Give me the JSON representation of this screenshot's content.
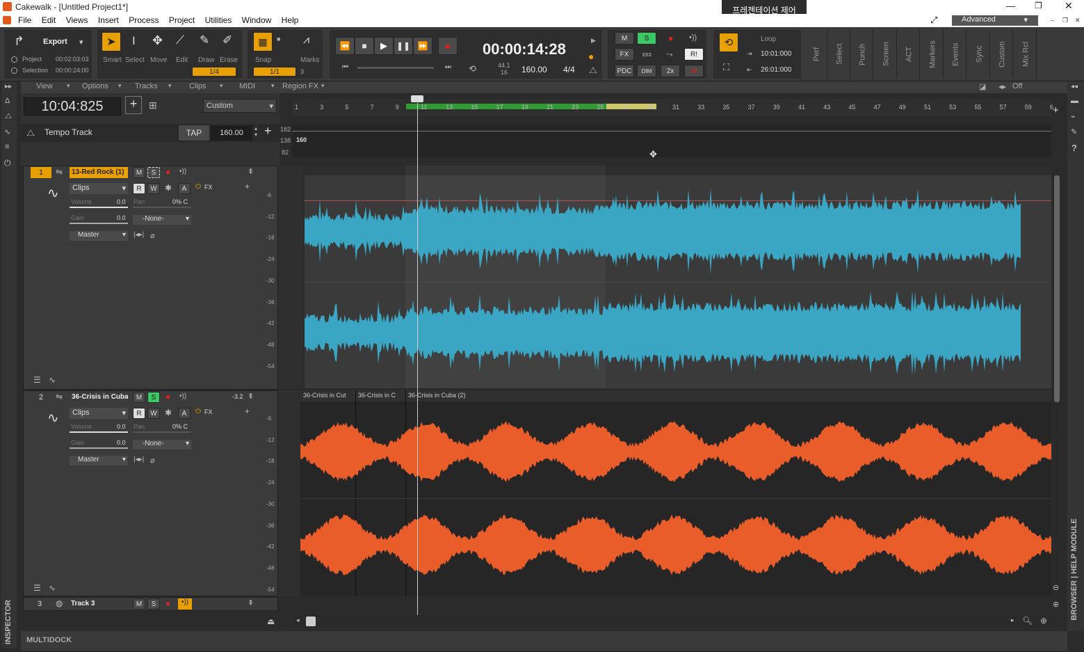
{
  "app": {
    "title": "Cakewalk - [Untitled Project1*]",
    "tooltip": "프레젠테이션 제어"
  },
  "menu": [
    "File",
    "Edit",
    "Views",
    "Insert",
    "Process",
    "Project",
    "Utilities",
    "Window",
    "Help"
  ],
  "workspace": "Advanced",
  "export": {
    "label": "Export",
    "project_label": "Project",
    "project_time": "00:02:03:03",
    "selection_label": "Selection",
    "selection_time": "00:00:24:00"
  },
  "tools": [
    "Smart",
    "Select",
    "Move",
    "Edit",
    "Draw",
    "Erase"
  ],
  "snap": {
    "label": "Snap",
    "value": "1/4",
    "value2": "1/1",
    "marks": "Marks",
    "marks_val": "3"
  },
  "transport": {
    "time": "00:00:14:28",
    "rate_top": "44.1",
    "rate_bottom": "16",
    "tempo": "160.00",
    "meter": "4/4"
  },
  "mix": {
    "m": "M",
    "s": "S",
    "fx": "FX",
    "pdc": "PDC",
    "dim": "DIM",
    "two_x": "2x",
    "w": "W",
    "ri": "R!"
  },
  "loop": {
    "label": "Loop",
    "start": "10:01:000",
    "end": "26:01:000"
  },
  "vtabs": [
    "Perf",
    "Select",
    "Punch",
    "Screen",
    "ACT",
    "Markers",
    "Events",
    "Sync",
    "Custom",
    "Mix Rcl"
  ],
  "viewbar": [
    "View",
    "Options",
    "Tracks",
    "Clips",
    "MIDI",
    "Region FX"
  ],
  "viewbar_right": "Off",
  "now_time": "10:04:825",
  "preset": "Custom",
  "tempo_track": {
    "label": "Tempo Track",
    "tap": "TAP",
    "value": "160.00",
    "lane_value": "160",
    "scale": [
      "182",
      "138",
      "82"
    ]
  },
  "ruler": [
    "1",
    "3",
    "5",
    "7",
    "9",
    "11",
    "13",
    "15",
    "17",
    "19",
    "21",
    "23",
    "25",
    "27",
    "29",
    "31",
    "33",
    "35",
    "37",
    "39",
    "41",
    "43",
    "45",
    "47",
    "49",
    "51",
    "53",
    "55",
    "57",
    "59",
    "6"
  ],
  "tracks": [
    {
      "num": "1",
      "name": "13-Red Rock (1)",
      "mode": "Clips",
      "volume_label": "Volume",
      "volume": "0.0",
      "pan_label": "Pan",
      "pan": "0% C",
      "gain_label": "Gain",
      "gain": "0.0",
      "input": "-None-",
      "output": "Master",
      "fx": "FX",
      "trim": ""
    },
    {
      "num": "2",
      "name": "36-Crisis in Cuba",
      "mode": "Clips",
      "volume_label": "Volume",
      "volume": "0.0",
      "pan_label": "Pan",
      "pan": "0% C",
      "gain_label": "Gain",
      "gain": "0.0",
      "input": "-None-",
      "output": "Master",
      "fx": "FX",
      "trim": "-3.2"
    },
    {
      "num": "3",
      "name": "Track 3"
    }
  ],
  "clips": [
    "36-Crisis in Cut",
    "36-Crisis in C",
    "36-Crisis in Cuba (2)"
  ],
  "meter_scale": [
    "-6",
    "-12",
    "-18",
    "-24",
    "-30",
    "-36",
    "-42",
    "-48",
    "-54"
  ],
  "buttons": {
    "m": "M",
    "s": "S",
    "r": "R",
    "w": "W",
    "a": "A"
  },
  "multidock": "MULTIDOCK",
  "inspector": "INSPECTOR",
  "browser": "BROWSER | HELP MODULE",
  "colors": {
    "track1": "#3aa6c4",
    "track2": "#e85d2a",
    "solo": "#3cc864",
    "record": "#e02020",
    "loop": "#e8a000"
  }
}
